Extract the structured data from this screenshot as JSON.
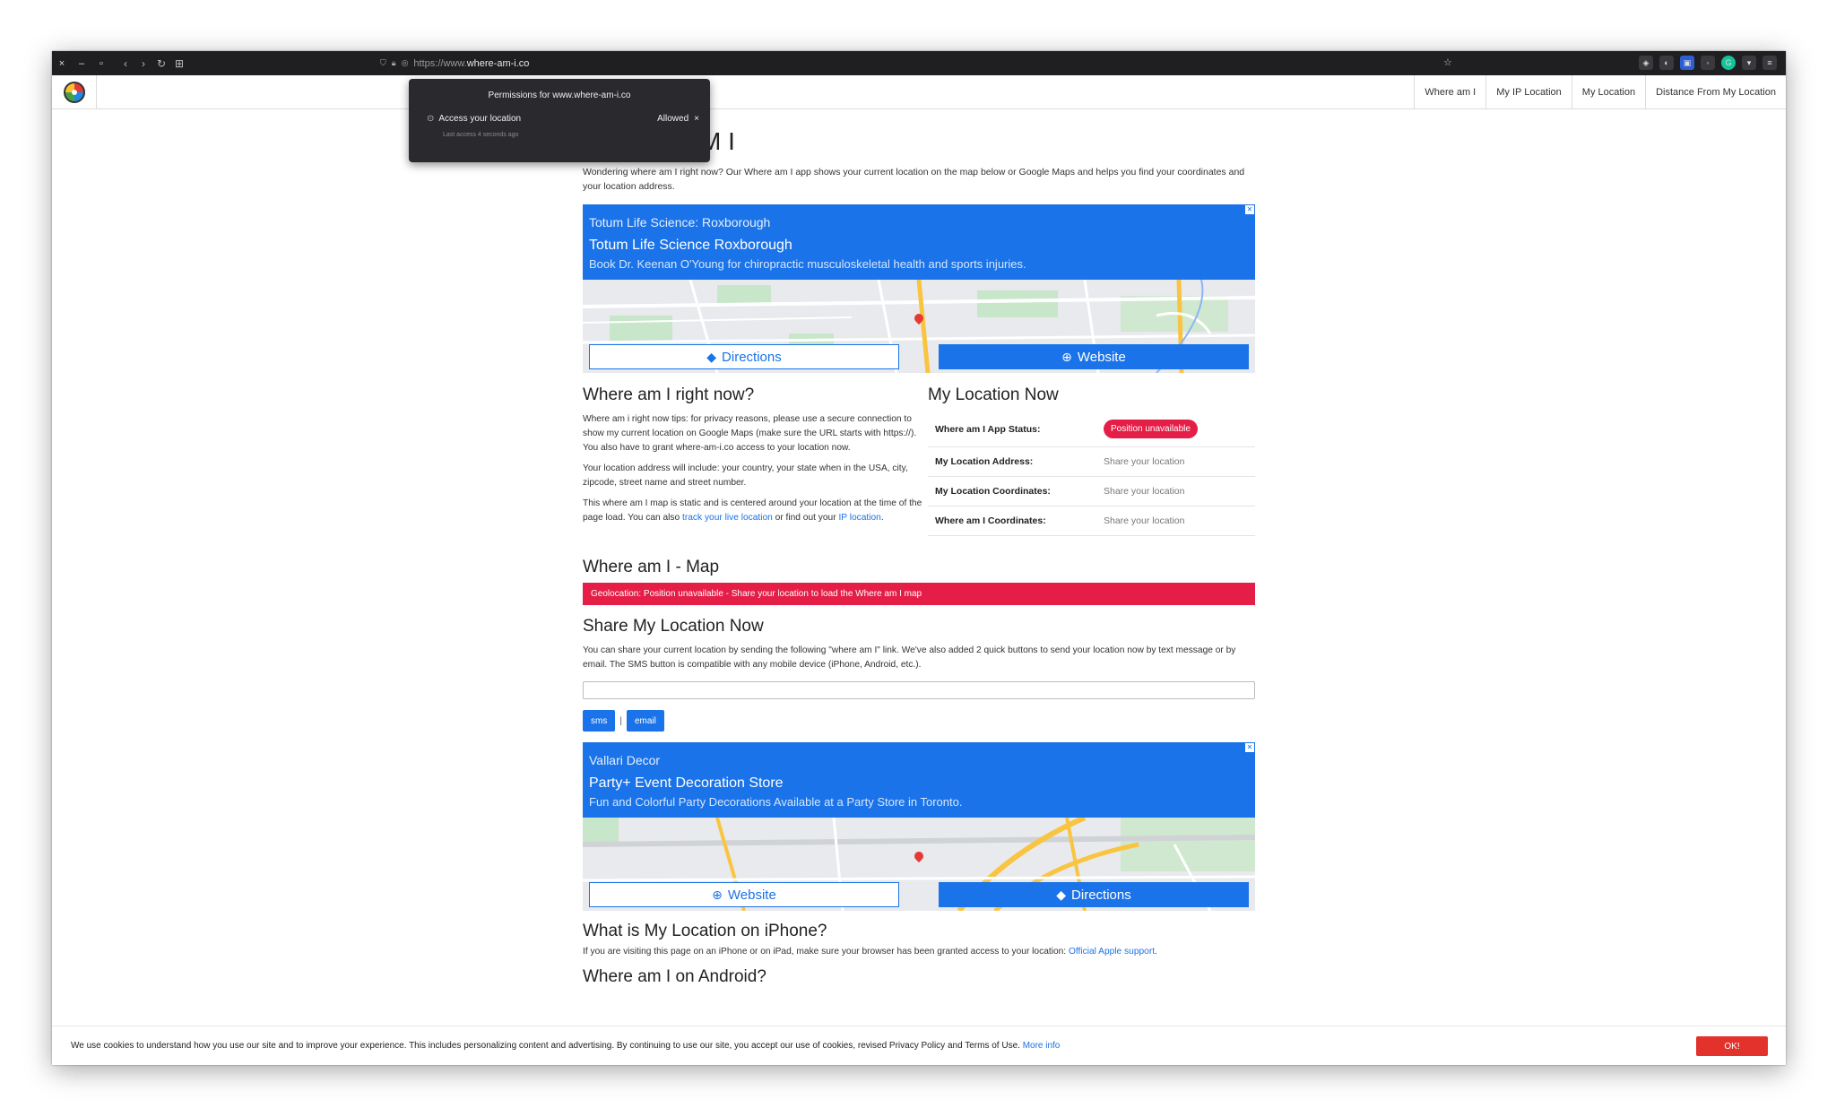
{
  "browser": {
    "url_prefix": "https://www.",
    "url_domain": "where-am-i.co",
    "window_controls": [
      "×",
      "–",
      "▫"
    ]
  },
  "nav": {
    "items": [
      "Where am I",
      "My IP Location",
      "My Location",
      "Distance From My Location"
    ]
  },
  "permissions": {
    "title": "Permissions for www.where-am-i.co",
    "item": "Access your location",
    "status": "Allowed",
    "close": "×",
    "last_access": "Last access 4 seconds ago"
  },
  "page": {
    "title_visible": "M I",
    "lead": "Wondering where am I right now? Our Where am I app shows your current location on the map below or Google Maps and helps you find your coordinates and your location address."
  },
  "ads": [
    {
      "advertiser": "Totum Life Science: Roxborough",
      "headline": "Totum Life Science Roxborough",
      "description": "Book Dr. Keenan O'Young for chiropractic musculoskeletal health and sports injuries.",
      "left_button": "Directions",
      "right_button": "Website"
    },
    {
      "advertiser": "Vallari Decor",
      "headline": "Party+ Event Decoration Store",
      "description": "Fun and Colorful Party Decorations Available at a Party Store in Toronto.",
      "left_button": "Website",
      "right_button": "Directions"
    }
  ],
  "right_now": {
    "heading": "Where am I right now?",
    "p1": "Where am i right now tips: for privacy reasons, please use a secure connection to show my current location on Google Maps (make sure the URL starts with https://). You also have to grant where-am-i.co access to your location now.",
    "p2": "Your location address will include: your country, your state when in the USA, city, zipcode, street name and street number.",
    "p3_a": "This where am I map is static and is centered around your location at the time of the page load. You can also ",
    "p3_link1": "track your live location",
    "p3_b": " or find out your ",
    "p3_link2": "IP location",
    "p3_c": "."
  },
  "location_now": {
    "heading": "My Location Now",
    "rows": [
      {
        "label": "Where am I App Status:",
        "value": "Position unavailable"
      },
      {
        "label": "My Location Address:",
        "value": "Share your location"
      },
      {
        "label": "My Location Coordinates:",
        "value": "Share your location"
      },
      {
        "label": "Where am I Coordinates:",
        "value": "Share your location"
      }
    ]
  },
  "map_section": {
    "heading": "Where am I - Map",
    "alert": "Geolocation: Position unavailable - Share your location to load the Where am I map"
  },
  "share": {
    "heading": "Share My Location Now",
    "text": "You can share your current location by sending the following \"where am I\" link. We've also added 2 quick buttons to send your location now by text message or by email. The SMS button is compatible with any mobile device (iPhone, Android, etc.).",
    "sms": "sms",
    "separator": "|",
    "email": "email"
  },
  "iphone": {
    "heading": "What is My Location on iPhone?",
    "text": "If you are visiting this page on an iPhone or on iPad, make sure your browser has been granted access to your location: ",
    "link": "Official Apple support",
    "end": "."
  },
  "android": {
    "heading": "Where am I on Android?"
  },
  "cookie": {
    "text": "We use cookies to understand how you use our site and to improve your experience. This includes personalizing content and advertising. By continuing to use our site, you accept our use of cookies, revised Privacy Policy and Terms of Use. ",
    "link": "More info",
    "ok": "OK!"
  }
}
